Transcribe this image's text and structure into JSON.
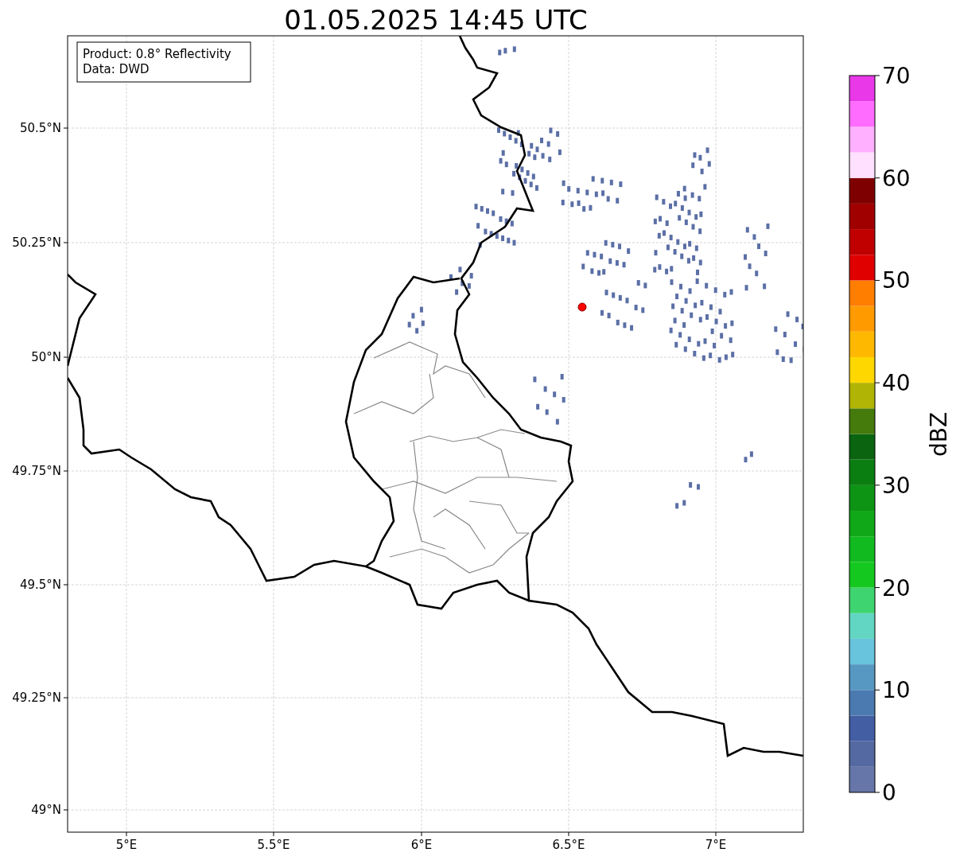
{
  "title": "01.05.2025 14:45 UTC",
  "info_box": [
    "Product: 0.8° Reflectivity",
    "Data: DWD"
  ],
  "y_ticks": [
    "50.5°N",
    "50.25°N",
    "50°N",
    "49.75°N",
    "49.5°N",
    "49.25°N",
    "49°N"
  ],
  "x_ticks": [
    "5°E",
    "5.5°E",
    "6°E",
    "6.5°E",
    "7°E"
  ],
  "colorbar": {
    "label": "dBZ",
    "ticks": [
      "70",
      "60",
      "50",
      "40",
      "30",
      "20",
      "10",
      "0"
    ],
    "bands": [
      {
        "color": "#6676a8"
      },
      {
        "color": "#5468a1"
      },
      {
        "color": "#435ea3"
      },
      {
        "color": "#4a7ab0"
      },
      {
        "color": "#5798c2"
      },
      {
        "color": "#68c3dc"
      },
      {
        "color": "#62d6c2"
      },
      {
        "color": "#3ed46f"
      },
      {
        "color": "#14c81f"
      },
      {
        "color": "#11bb1f"
      },
      {
        "color": "#10a818"
      },
      {
        "color": "#0d9415"
      },
      {
        "color": "#0b7e12"
      },
      {
        "color": "#0a6410"
      },
      {
        "color": "#457a0c"
      },
      {
        "color": "#b0b404"
      },
      {
        "color": "#ffd700"
      },
      {
        "color": "#ffb800"
      },
      {
        "color": "#ff9a00"
      },
      {
        "color": "#ff7e00"
      },
      {
        "color": "#e00000"
      },
      {
        "color": "#c00000"
      },
      {
        "color": "#a00000"
      },
      {
        "color": "#7e0000"
      },
      {
        "color": "#ffe0ff"
      },
      {
        "color": "#ffb0ff"
      },
      {
        "color": "#ff6cff"
      },
      {
        "color": "#e838e8"
      }
    ]
  }
}
